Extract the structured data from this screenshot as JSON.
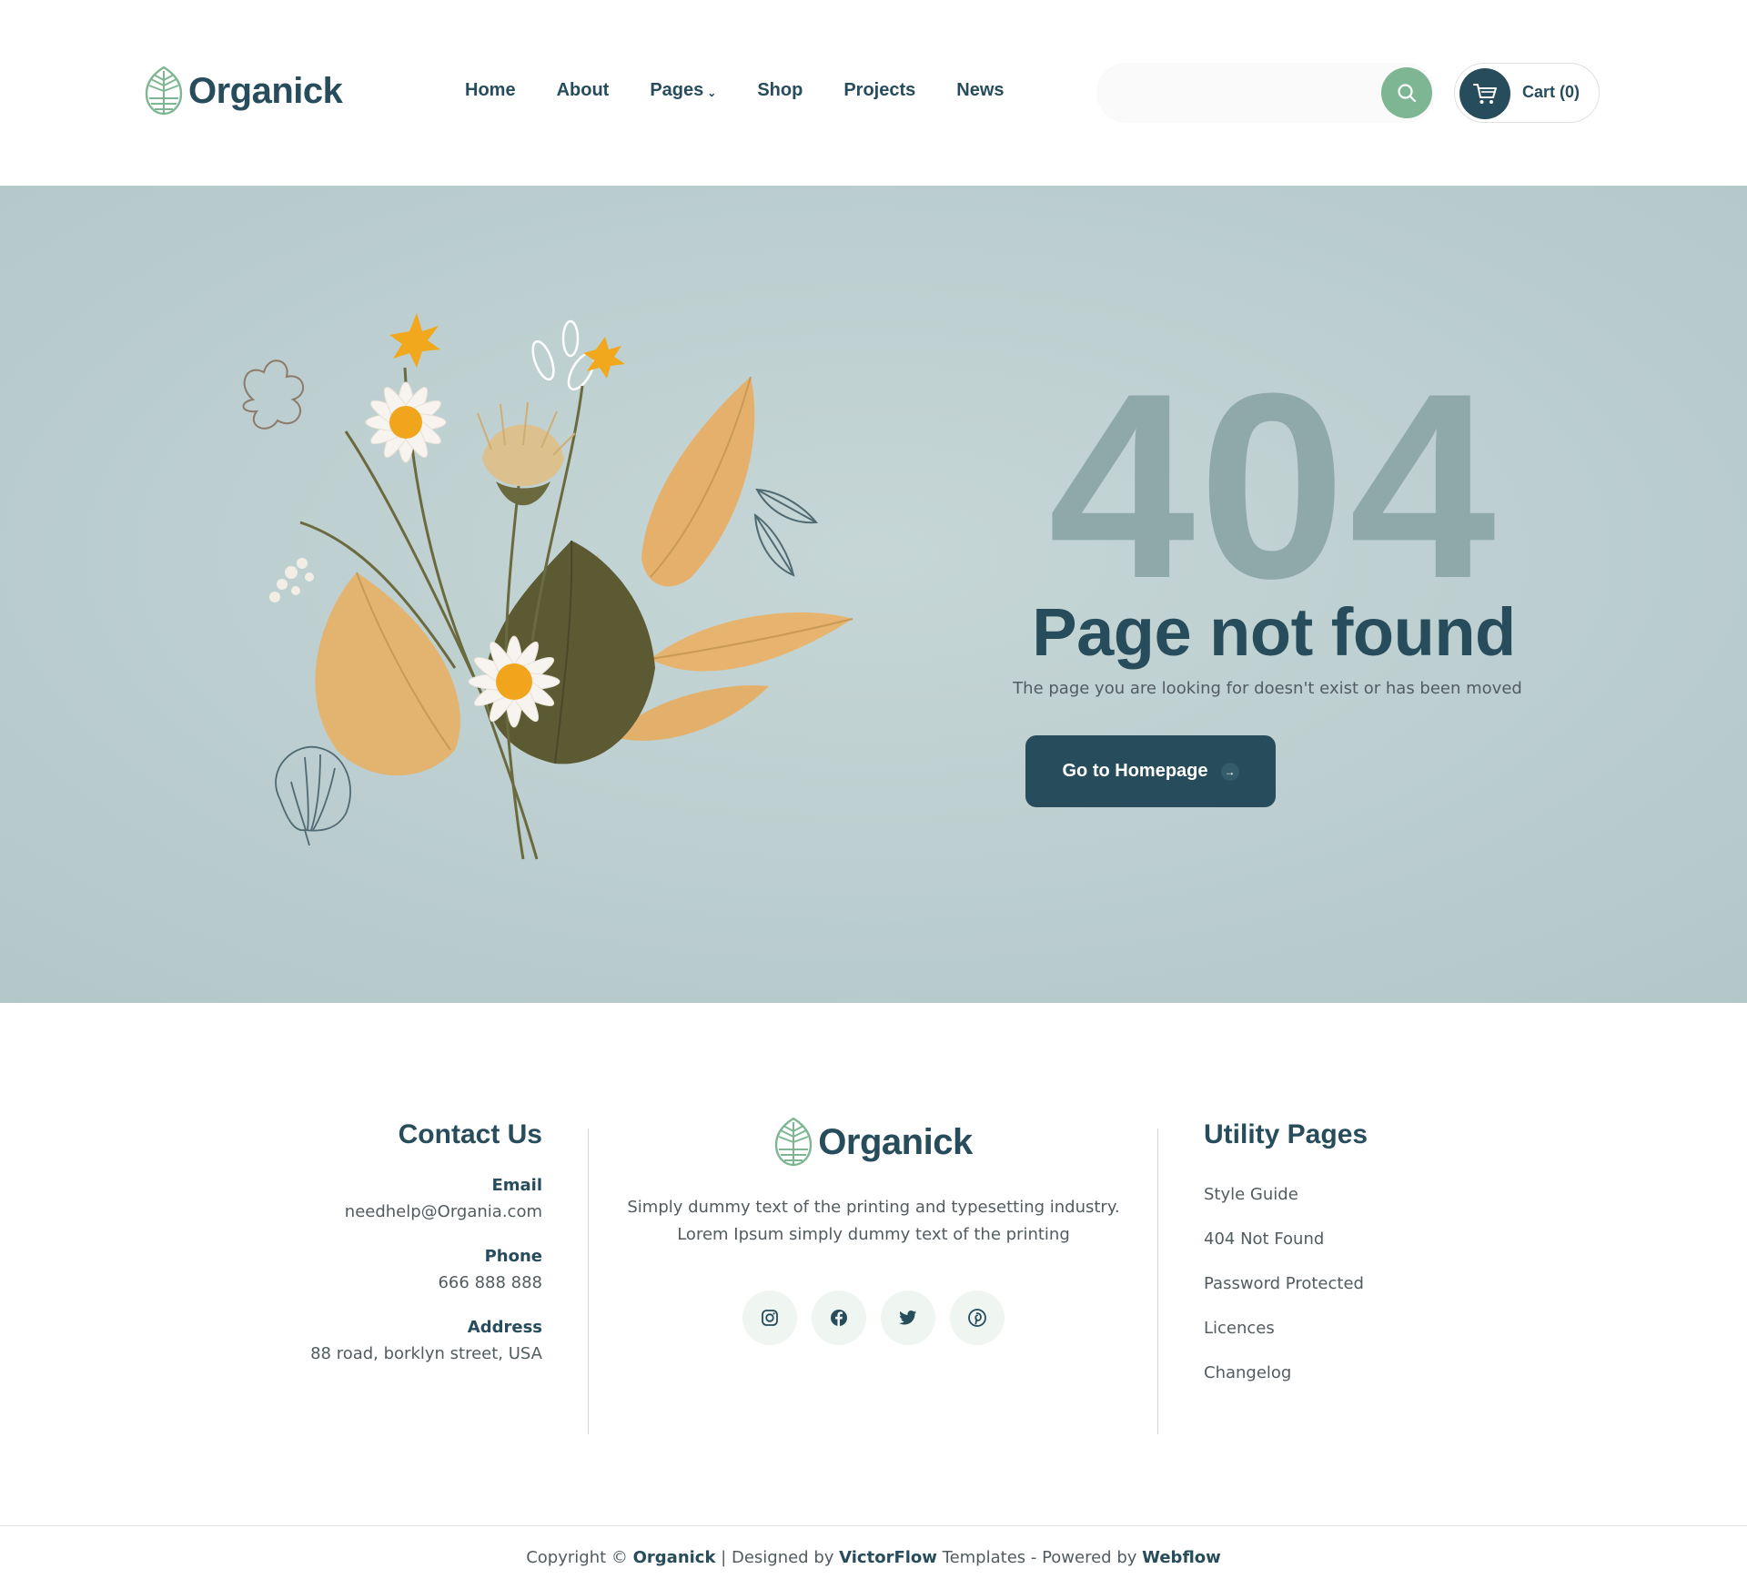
{
  "brand": {
    "name": "Organick"
  },
  "nav": {
    "items": [
      {
        "label": "Home"
      },
      {
        "label": "About"
      },
      {
        "label": "Pages",
        "has_dropdown": true
      },
      {
        "label": "Shop"
      },
      {
        "label": "Projects"
      },
      {
        "label": "News"
      }
    ]
  },
  "search": {
    "placeholder": ""
  },
  "cart": {
    "label": "Cart (0)"
  },
  "hero": {
    "code": "404",
    "title": "Page not found",
    "subtitle": "The page you are looking for doesn't exist or has been moved",
    "button_label": "Go to Homepage"
  },
  "footer": {
    "contact": {
      "title": "Contact Us",
      "items": [
        {
          "label": "Email",
          "value": "needhelp@Organia.com"
        },
        {
          "label": "Phone",
          "value": "666 888 888"
        },
        {
          "label": "Address",
          "value": "88 road, borklyn street, USA"
        }
      ]
    },
    "center": {
      "brand": "Organick",
      "desc_line1": "Simply dummy text of the printing and typesetting industry.",
      "desc_line2": "Lorem Ipsum simply dummy text of the printing",
      "socials": [
        "instagram-icon",
        "facebook-icon",
        "twitter-icon",
        "pinterest-icon"
      ]
    },
    "utility": {
      "title": "Utility Pages",
      "items": [
        "Style Guide",
        "404 Not Found",
        "Password Protected",
        "Licences",
        "Changelog"
      ]
    }
  },
  "copyright": {
    "prefix": "Copyright © ",
    "brand": "Organick",
    "mid1": " | Designed by ",
    "designer": "VictorFlow",
    "mid2": " Templates - Powered by ",
    "platform": "Webflow"
  },
  "colors": {
    "primary": "#274c5b",
    "accent_green": "#7eb693",
    "hero_bg": "#bfd0d1",
    "code_color": "#8fa9a8"
  }
}
